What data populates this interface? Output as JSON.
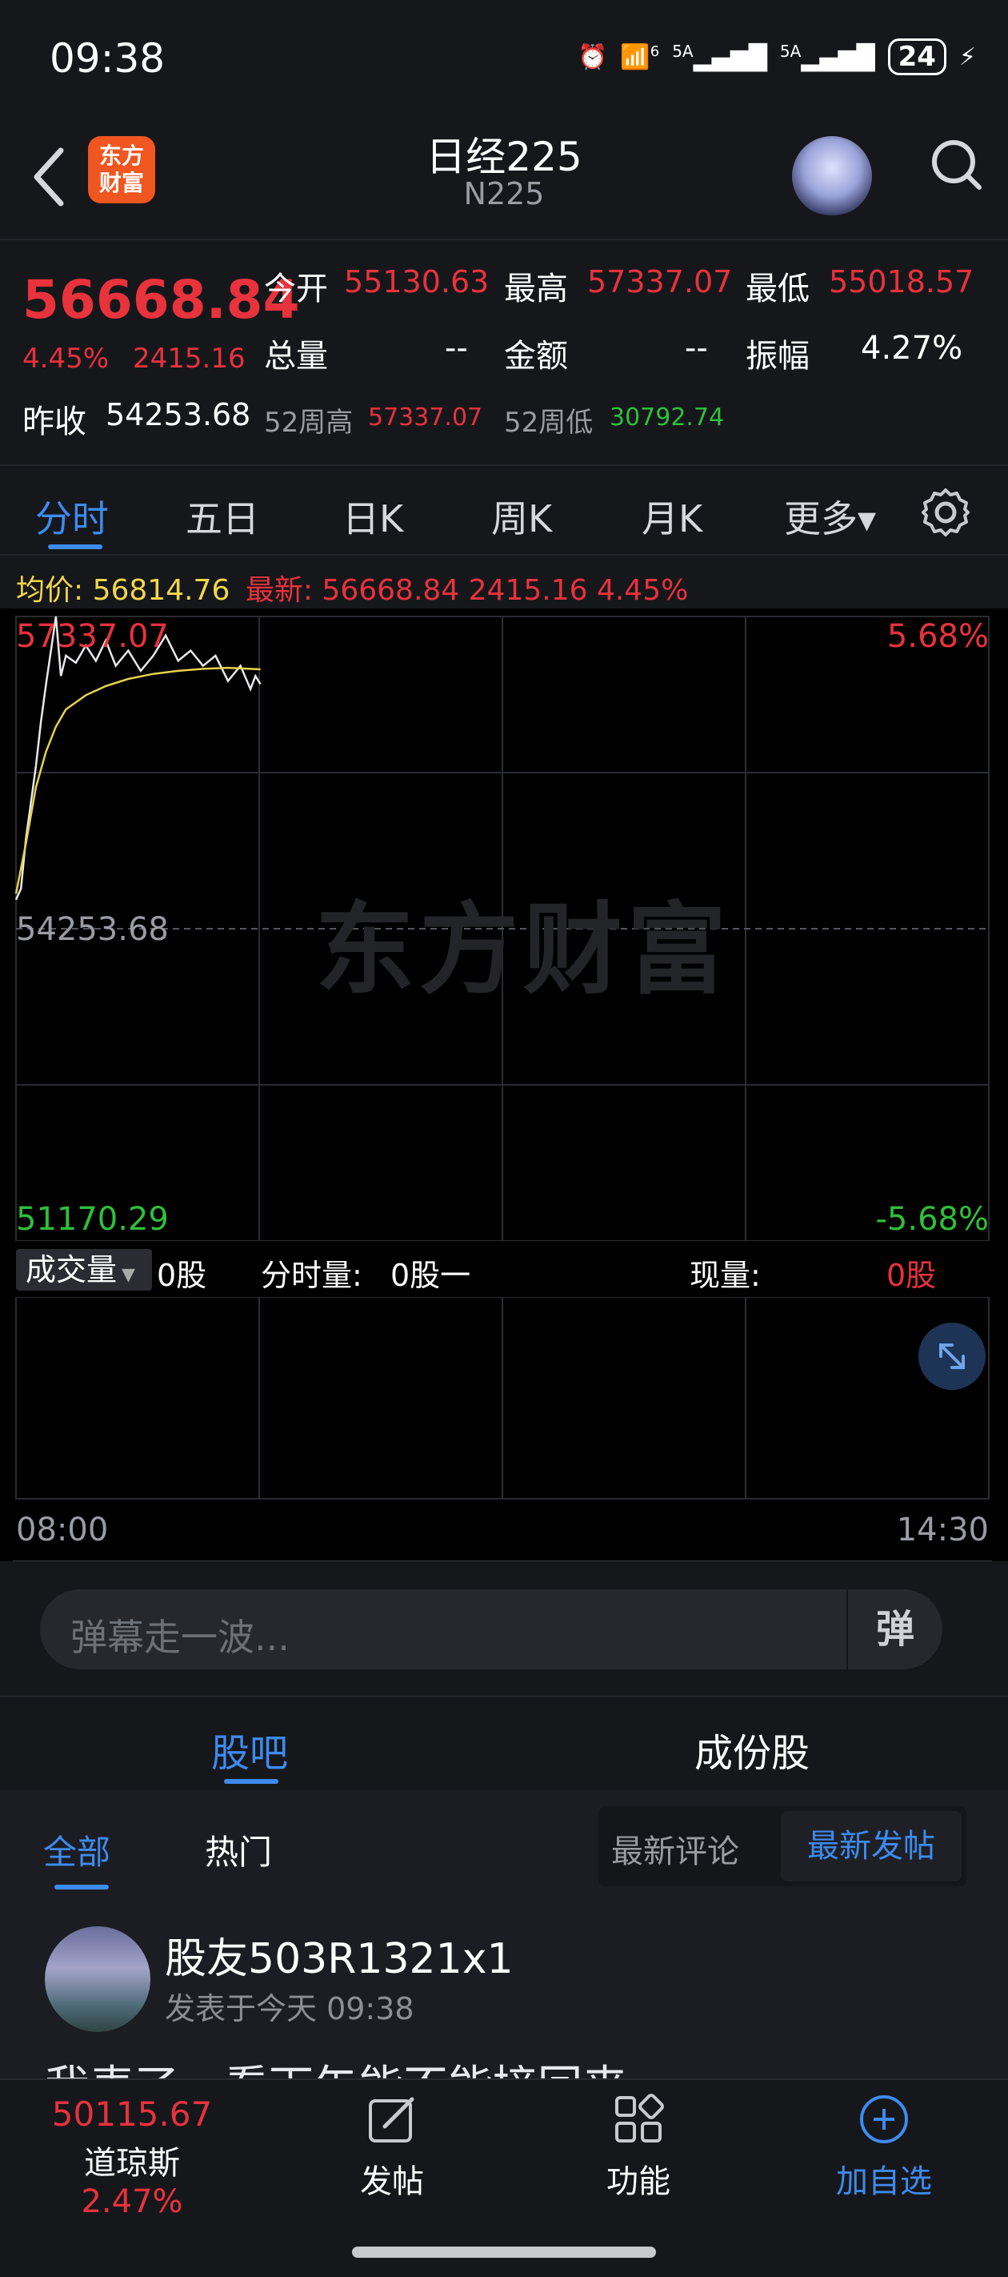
{
  "status_bar": {
    "time": "09:38",
    "signal_1": "5A",
    "signal_2": "5A",
    "wifi_badge": "6",
    "battery": "24"
  },
  "header": {
    "title": "日经225",
    "subtitle": "N225",
    "logo_text": "东方财富"
  },
  "quote": {
    "price": "56668.84",
    "change_pct": "4.45%",
    "change_amt": "2415.16",
    "prev_close_label": "昨收",
    "prev_close": "54253.68",
    "open_label": "今开",
    "open": "55130.63",
    "high_label": "最高",
    "high": "57337.07",
    "low_label": "最低",
    "low": "55018.57",
    "volume_label": "总量",
    "volume": "--",
    "amount_label": "金额",
    "amount": "--",
    "amplitude_label": "振幅",
    "amplitude": "4.27%",
    "wk52_high_label": "52周高",
    "wk52_high": "57337.07",
    "wk52_low_label": "52周低",
    "wk52_low": "30792.74"
  },
  "ktabs": [
    "分时",
    "五日",
    "日K",
    "周K",
    "月K",
    "更多▾"
  ],
  "legend": {
    "avg_label": "均价:",
    "avg_value": "56814.76",
    "latest_label": "最新:",
    "latest_value": "56668.84 2415.16 4.45%"
  },
  "chart_axes": {
    "top_left": "57337.07",
    "mid_left": "54253.68",
    "bottom_left": "51170.29",
    "top_right": "5.68%",
    "bottom_right": "-5.68%",
    "start_time": "08:00",
    "end_time": "14:30",
    "watermark": "东方财富"
  },
  "volume_bar": {
    "selector": "成交量",
    "selector_value": "0股",
    "minute_label": "分时量:",
    "minute_value": "0股一",
    "current_label": "现量:",
    "current_value": "0股"
  },
  "danmu": {
    "placeholder": "弹幕走一波...",
    "button": "弹"
  },
  "section_tabs": [
    "股吧",
    "成份股"
  ],
  "feed": {
    "filters": [
      "全部",
      "热门"
    ],
    "sort_options": [
      "最新评论",
      "最新发帖"
    ],
    "post": {
      "user": "股友503R1321x1",
      "time": "发表于今天 09:38",
      "text": "我表了，看下午能不能接回来"
    }
  },
  "bottom_nav": {
    "index_value": "50115.67",
    "index_name": "道琼斯",
    "index_change": "2.47%",
    "post": "发帖",
    "functions": "功能",
    "add_watch": "加自选"
  },
  "chart_data": {
    "type": "line",
    "title": "",
    "xlabel": "",
    "ylabel": "",
    "x_range": [
      "08:00",
      "14:30"
    ],
    "ylim": [
      51170.29,
      57337.07
    ],
    "reference_line": 54253.68,
    "grid": true,
    "series": [
      {
        "name": "最新",
        "x": [
          "08:00",
          "08:02",
          "08:04",
          "08:06",
          "08:08",
          "08:10",
          "08:12",
          "08:14",
          "08:16",
          "08:18",
          "08:20",
          "08:24",
          "08:28",
          "08:32",
          "08:36",
          "08:40",
          "08:45",
          "08:50",
          "08:55",
          "09:00",
          "09:05",
          "09:10",
          "09:15",
          "09:20",
          "09:25",
          "09:30",
          "09:34",
          "09:36",
          "09:38"
        ],
        "values": [
          54540,
          54650,
          55150,
          55500,
          55860,
          56300,
          56660,
          57000,
          57337,
          56750,
          56950,
          56880,
          57050,
          56900,
          57100,
          56850,
          57000,
          56800,
          56950,
          57150,
          56900,
          57000,
          56850,
          56950,
          56700,
          56850,
          56620,
          56750,
          56669
        ]
      },
      {
        "name": "均价",
        "x": [
          "08:00",
          "08:04",
          "08:08",
          "08:12",
          "08:16",
          "08:20",
          "08:28",
          "08:36",
          "08:45",
          "08:55",
          "09:05",
          "09:15",
          "09:25",
          "09:38"
        ],
        "values": [
          54600,
          55100,
          55650,
          56000,
          56250,
          56420,
          56560,
          56650,
          56720,
          56770,
          56800,
          56820,
          56830,
          56815
        ]
      }
    ]
  }
}
